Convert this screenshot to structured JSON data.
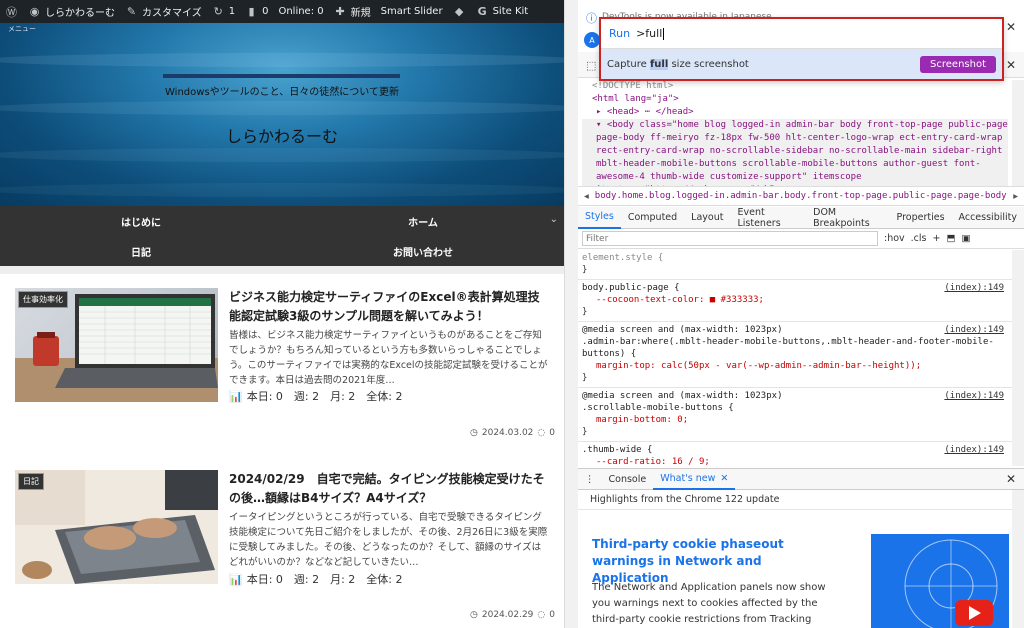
{
  "adminbar": {
    "site_name": "しらかわるーむ",
    "customize": "カスタマイズ",
    "updates": "1",
    "comments": "0",
    "online": "Online: 0",
    "new": "新規",
    "smart_slider": "Smart Slider",
    "site_kit": "Site Kit"
  },
  "header": {
    "menu_label": "メニュー",
    "tagline": "Windowsやツールのこと、日々の徒然について更新",
    "site_title": "しらかわるーむ"
  },
  "nav": {
    "items": [
      "はじめに",
      "ホーム",
      "日記",
      "お問い合わせ"
    ]
  },
  "posts": [
    {
      "category": "仕事効率化",
      "title": "ビジネス能力検定サーティファイのExcel®表計算処理技能認定試験3級のサンプル問題を解いてみよう！",
      "excerpt": "皆様は、ビジネス能力検定サーティファイというものがあることをご存知でしょうか？もちろん知っているという方も多数いらっしゃることでしょう。このサーティファイでは実務的なExcelの技能認定試験を受けることができます。本日は過去問の2021年度…",
      "stats": "本日: 0　週: 2　月: 2　全体: 2",
      "date": "2024.03.02",
      "comments": "0"
    },
    {
      "category": "日記",
      "title": "2024/02/29　自宅で完結。タイピング技能検定受けたその後…額縁はB4サイズ？A4サイズ？",
      "excerpt": "イータイピングというところが行っている、自宅で受験できるタイピング技能検定について先日ご紹介をしましたが、その後、2月26日に3級を実際に受験してみました。その後、どうなったのか？そして、額縁のサイズはどれがいいのか？などなど記していきたい…",
      "stats": "本日: 0　週: 2　月: 2　全体: 2",
      "date": "2024.02.29",
      "comments": "0"
    }
  ],
  "devtools": {
    "command": {
      "prefix": "Run",
      "query": ">full",
      "suggestion_pre": "Capture ",
      "suggestion_match": "full",
      "suggestion_post": " size screenshot",
      "button": "Screenshot"
    },
    "dom": {
      "doctype": "<!DOCTYPE html>",
      "html": "<html lang=\"ja\">",
      "head": "<head> ⋯ </head>",
      "body": "<body class=\"home blog logged-in admin-bar body front-top-page public-page page-body ff-meiryo fz-18px fw-500 hlt-center-logo-wrap ect-entry-card-wrap rect-entry-card-wrap no-scrollable-sidebar no-scrollable-main sidebar-right mblt-header-mobile-buttons scrollable-mobile-buttons author-guest font-awesome-4 thumb-wide customize-support\" itemscope itemtype=\"https://schema.org/WebPag"
    },
    "breadcrumb": "body.home.blog.logged-in.admin-bar.body.front-top-page.public-page.page-body.ff-meiryo.fz",
    "tabs": [
      "Styles",
      "Computed",
      "Layout",
      "Event Listeners",
      "DOM Breakpoints",
      "Properties",
      "Accessibility"
    ],
    "filter_placeholder": "Filter",
    "hov": ":hov",
    "cls": ".cls",
    "rules": [
      {
        "selector": "element.style {",
        "lines": [],
        "source": ""
      },
      {
        "selector": "body.public-page {",
        "lines": [
          "--cocoon-text-color: ■ #333333;"
        ],
        "source": "(index):149"
      },
      {
        "selector": "@media screen and (max-width: 1023px)\n.admin-bar:where(.mblt-header-mobile-buttons,.mblt-header-and-footer-mobile-buttons) {",
        "lines": [
          "margin-top: calc(50px - var(--wp-admin--admin-bar--height));"
        ],
        "source": "(index):149"
      },
      {
        "selector": "@media screen and (max-width: 1023px)\n.scrollable-mobile-buttons {",
        "lines": [
          "margin-bottom: 0;"
        ],
        "source": "(index):149"
      },
      {
        "selector": ".thumb-wide {",
        "lines": [
          "--card-ratio: 16 / 9;"
        ],
        "source": "(index):149"
      }
    ],
    "drawer": {
      "tabs": [
        "Console",
        "What's new"
      ],
      "highlights": "Highlights from the Chrome 122 update",
      "headline": "Third-party cookie phaseout warnings in Network and Application",
      "body": "The Network and Application panels now show you warnings next to cookies affected by the third-party cookie restrictions from Tracking"
    },
    "infobar": "DevTools is now available in Japanese"
  },
  "colors": {
    "adminbar": "#1d2327",
    "nav": "#333333",
    "accent": "#1a73e8",
    "screenshot_button": "#9b2ab2",
    "highlight_red": "#cc2222"
  }
}
